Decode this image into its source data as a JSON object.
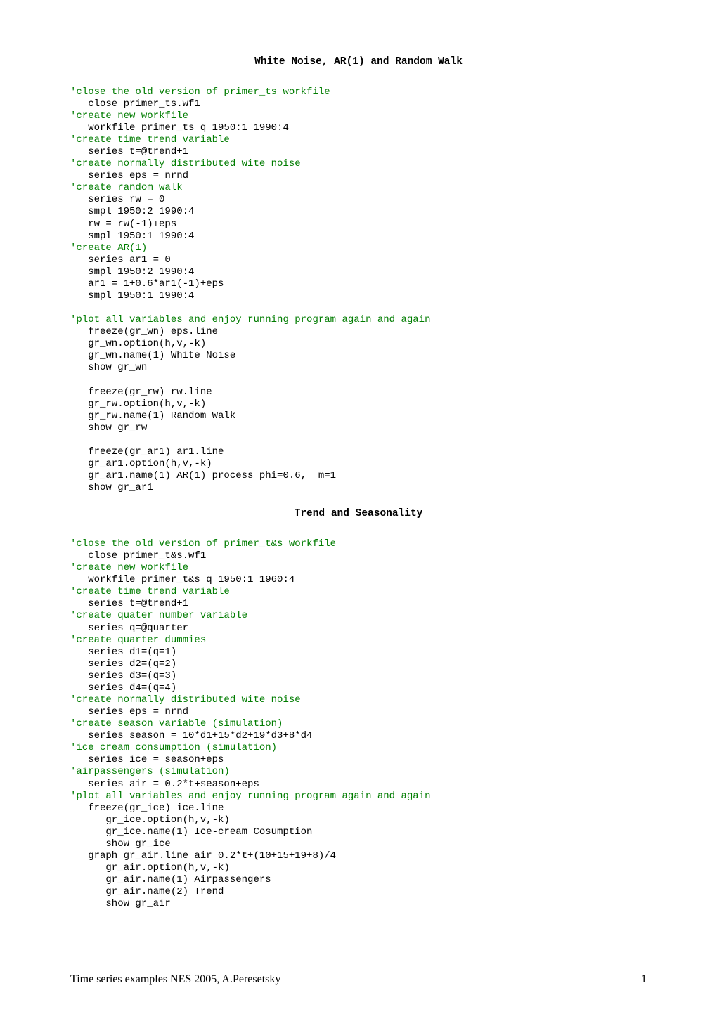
{
  "title1": "White Noise,  AR(1)  and  Random Walk",
  "title2": "Trend and Seasonality",
  "footer_left": "Time series examples NES 2005, A.Peresetsky",
  "footer_right": "1",
  "block1": [
    {
      "c": "'close the old version of primer_ts workfile",
      "i": 0
    },
    {
      "t": "close primer_ts.wf1",
      "i": 1
    },
    {
      "c": "'create new workfile",
      "i": 0
    },
    {
      "t": "workfile primer_ts q 1950:1 1990:4",
      "i": 1
    },
    {
      "c": "'create time trend variable",
      "i": 0
    },
    {
      "t": "series t=@trend+1",
      "i": 1
    },
    {
      "c": "'create normally distributed wite noise",
      "i": 0
    },
    {
      "t": "series eps = nrnd",
      "i": 1
    },
    {
      "c": "'create random walk",
      "i": 0
    },
    {
      "t": "series rw = 0",
      "i": 1
    },
    {
      "t": "smpl 1950:2 1990:4",
      "i": 1
    },
    {
      "t": "rw = rw(-1)+eps",
      "i": 1
    },
    {
      "t": "smpl 1950:1 1990:4",
      "i": 1
    },
    {
      "c": "'create AR(1)",
      "i": 0
    },
    {
      "t": "series ar1 = 0",
      "i": 1
    },
    {
      "t": "smpl 1950:2 1990:4",
      "i": 1
    },
    {
      "t": "ar1 = 1+0.6*ar1(-1)+eps",
      "i": 1
    },
    {
      "t": "smpl 1950:1 1990:4",
      "i": 1
    },
    {
      "t": "",
      "i": 0
    },
    {
      "c": "'plot all variables and enjoy running program again and again",
      "i": 0
    },
    {
      "t": "freeze(gr_wn) eps.line",
      "i": 1
    },
    {
      "t": "gr_wn.option(h,v,-k)",
      "i": 1
    },
    {
      "t": "gr_wn.name(1) White Noise",
      "i": 1
    },
    {
      "t": "show gr_wn",
      "i": 1
    },
    {
      "t": "",
      "i": 0
    },
    {
      "t": "freeze(gr_rw) rw.line",
      "i": 1
    },
    {
      "t": "gr_rw.option(h,v,-k)",
      "i": 1
    },
    {
      "t": "gr_rw.name(1) Random Walk",
      "i": 1
    },
    {
      "t": "show gr_rw",
      "i": 1
    },
    {
      "t": "",
      "i": 0
    },
    {
      "t": "freeze(gr_ar1) ar1.line",
      "i": 1
    },
    {
      "t": "gr_ar1.option(h,v,-k)",
      "i": 1
    },
    {
      "t": "gr_ar1.name(1) AR(1) process phi=0.6,  m=1",
      "i": 1
    },
    {
      "t": "show gr_ar1",
      "i": 1
    }
  ],
  "block2": [
    {
      "c": "'close the old version of primer_t&s workfile",
      "i": 0
    },
    {
      "t": "close primer_t&s.wf1",
      "i": 1
    },
    {
      "c": "'create new workfile",
      "i": 0
    },
    {
      "t": "workfile primer_t&s q 1950:1 1960:4",
      "i": 1
    },
    {
      "c": "'create time trend variable",
      "i": 0
    },
    {
      "t": "series t=@trend+1",
      "i": 1
    },
    {
      "c": "'create quater number variable",
      "i": 0
    },
    {
      "t": "series q=@quarter",
      "i": 1
    },
    {
      "c": "'create quarter dummies",
      "i": 0
    },
    {
      "t": "series d1=(q=1)",
      "i": 1
    },
    {
      "t": "series d2=(q=2)",
      "i": 1
    },
    {
      "t": "series d3=(q=3)",
      "i": 1
    },
    {
      "t": "series d4=(q=4)",
      "i": 1
    },
    {
      "c": "'create normally distributed wite noise",
      "i": 0
    },
    {
      "t": "series eps = nrnd",
      "i": 1
    },
    {
      "c": "'create season variable (simulation)",
      "i": 0
    },
    {
      "t": "series season = 10*d1+15*d2+19*d3+8*d4",
      "i": 1
    },
    {
      "c": "'ice cream consumption (simulation)",
      "i": 0
    },
    {
      "t": "series ice = season+eps",
      "i": 1
    },
    {
      "c": "'airpassengers (simulation)",
      "i": 0
    },
    {
      "t": "series air = 0.2*t+season+eps",
      "i": 1
    },
    {
      "c": "'plot all variables and enjoy running program again and again",
      "i": 0
    },
    {
      "t": "freeze(gr_ice) ice.line",
      "i": 1
    },
    {
      "t": "gr_ice.option(h,v,-k)",
      "i": 2
    },
    {
      "t": "gr_ice.name(1) Ice-cream Cosumption",
      "i": 2
    },
    {
      "t": "show gr_ice",
      "i": 2
    },
    {
      "t": "graph gr_air.line air 0.2*t+(10+15+19+8)/4",
      "i": 1
    },
    {
      "t": "gr_air.option(h,v,-k)",
      "i": 2
    },
    {
      "t": "gr_air.name(1) Airpassengers",
      "i": 2
    },
    {
      "t": "gr_air.name(2) Trend",
      "i": 2
    },
    {
      "t": "show gr_air",
      "i": 2
    }
  ]
}
